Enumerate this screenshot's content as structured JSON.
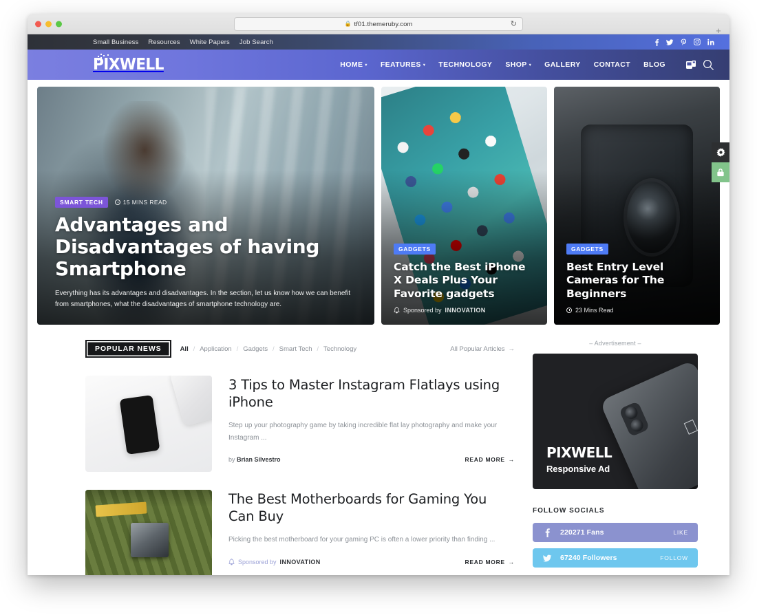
{
  "browser": {
    "url": "tf01.themeruby.com",
    "lock_icon": "lock-icon",
    "reload_icon": "reload-icon",
    "new_tab_label": "+"
  },
  "topbar": {
    "links": [
      "Small Business",
      "Resources",
      "White Papers",
      "Job Search"
    ],
    "socials": [
      "facebook-icon",
      "twitter-icon",
      "pinterest-icon",
      "instagram-icon",
      "linkedin-icon"
    ]
  },
  "header": {
    "logo": "PIXWELL",
    "menu": [
      {
        "label": "HOME",
        "caret": "▾"
      },
      {
        "label": "FEATURES",
        "caret": "▾"
      },
      {
        "label": "TECHNOLOGY",
        "caret": ""
      },
      {
        "label": "SHOP",
        "caret": "▾"
      },
      {
        "label": "GALLERY",
        "caret": ""
      },
      {
        "label": "CONTACT",
        "caret": ""
      },
      {
        "label": "BLOG",
        "caret": ""
      }
    ],
    "icons": [
      "dark-mode-icon",
      "search-icon"
    ]
  },
  "hero": {
    "main": {
      "category": "SMART TECH",
      "read_time": "15 MINS READ",
      "title": "Advantages and Disadvantages of having Smartphone",
      "excerpt": "Everything has its advantages and disadvantages. In the section, let us know how we can benefit from smartphones, what the disadvantages of smartphone technology are."
    },
    "side": [
      {
        "category": "GADGETS",
        "title": "Catch the Best iPhone X Deals Plus Your Favorite gadgets",
        "meta_prefix": "Sponsored by",
        "meta_brand": "INNOVATION",
        "meta_icon": "bell-icon"
      },
      {
        "category": "GADGETS",
        "title": "Best Entry Level Cameras for The Beginners",
        "meta_prefix": "23 Mins Read",
        "meta_brand": "",
        "meta_icon": "clock-icon"
      }
    ]
  },
  "popular": {
    "section_label": "POPULAR NEWS",
    "filters": [
      "All",
      "Application",
      "Gadgets",
      "Smart Tech",
      "Technology"
    ],
    "filter_separator": "/",
    "all_link": "All Popular Articles",
    "arrow": "→",
    "posts": [
      {
        "thumb": "flatlay-phone-photo",
        "title": "3 Tips to Master Instagram Flatlays using iPhone",
        "excerpt": "Step up your photography game by taking incredible flat lay photography and make your Instagram ...",
        "meta_type": "author",
        "meta_by": "by ",
        "meta_name": "Brian Silvestro",
        "read_more": "READ MORE"
      },
      {
        "thumb": "motherboard-photo",
        "title": "The Best Motherboards for Gaming You Can Buy",
        "excerpt": "Picking the best motherboard for your gaming PC is often a lower priority than finding ...",
        "meta_type": "sponsored",
        "meta_by": "Sponsored by",
        "meta_name": "INNOVATION",
        "read_more": "READ MORE"
      }
    ]
  },
  "sidebar": {
    "ad_label": "– Advertisement –",
    "ad_brand": "PIXWELL",
    "ad_sub": "Responsive Ad",
    "follow_title": "FOLLOW SOCIALS",
    "socials": [
      {
        "network": "facebook-icon",
        "count": "220271 Fans",
        "action": "LIKE"
      },
      {
        "network": "twitter-icon",
        "count": "67240 Followers",
        "action": "FOLLOW"
      }
    ]
  },
  "floating": {
    "gear": "gear-icon",
    "lock": "lock-icon"
  },
  "colors": {
    "accent_purple": "#7c55d8",
    "accent_blue": "#4e7bf5",
    "nav_gradient_start": "#7b7fe0",
    "nav_gradient_end": "#353e72",
    "facebook": "#8b92cf",
    "twitter": "#6ec7ee",
    "lock_green": "#82c48b"
  }
}
